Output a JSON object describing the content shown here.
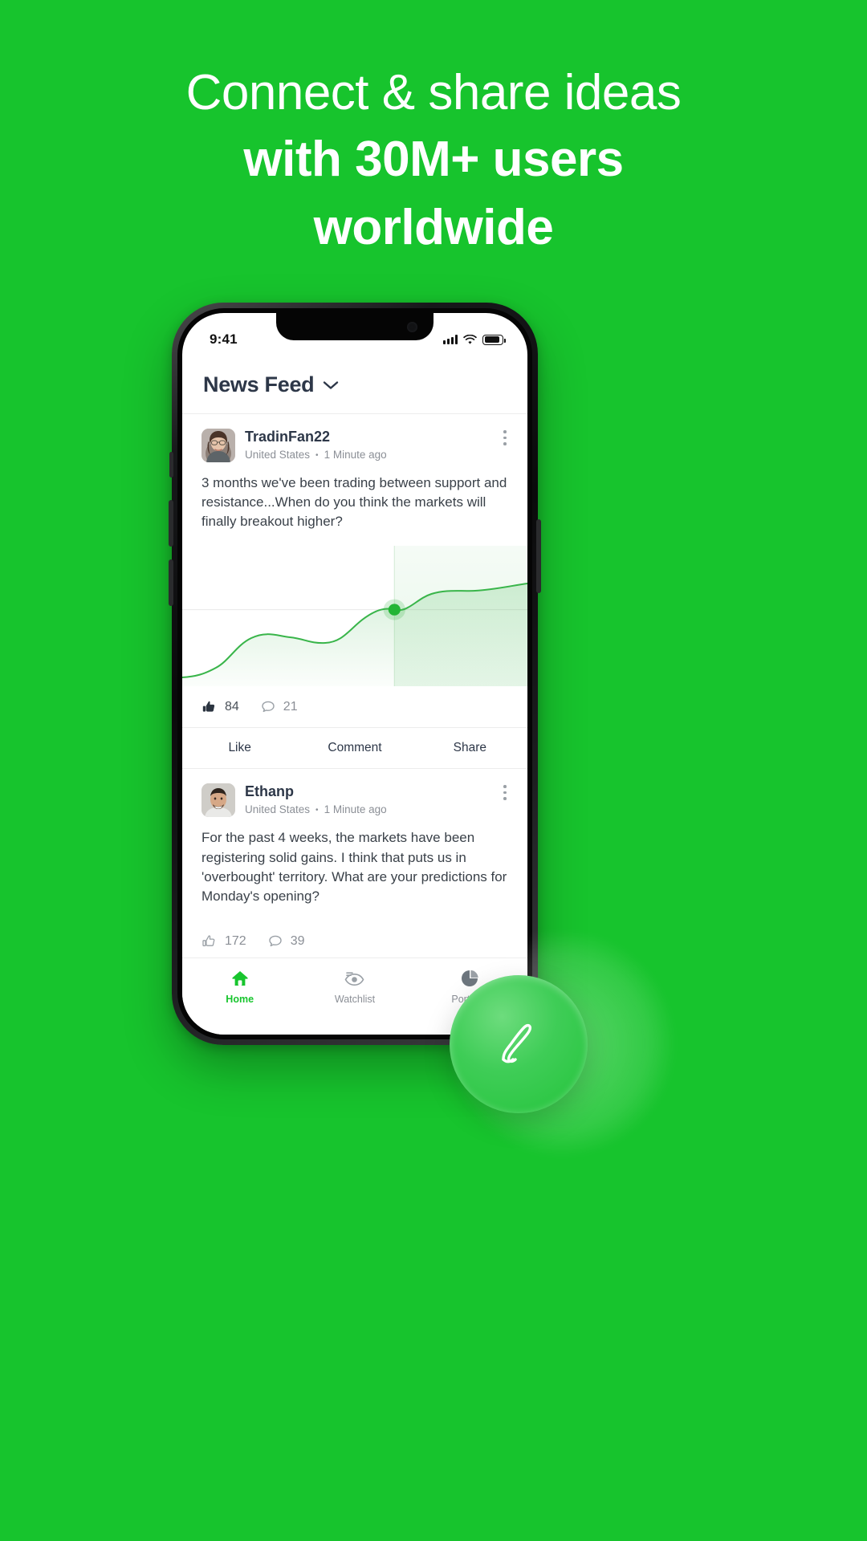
{
  "background_color": "#17C42D",
  "headline": {
    "line1": "Connect & share ideas",
    "line2": "with 30M+ users",
    "line3": "worldwide"
  },
  "phone": {
    "status_bar": {
      "time": "9:41",
      "signal_icon": "cellular-signal-icon",
      "wifi_icon": "wifi-icon",
      "battery_icon": "battery-icon"
    },
    "app_header": {
      "title": "News Feed",
      "chevron_icon": "chevron-down-icon"
    },
    "posts": [
      {
        "author": "TradinFan22",
        "location": "United States",
        "separator": "•",
        "time": "1 Minute ago",
        "menu_icon": "kebab-menu-icon",
        "avatar_name": "avatar-tradinfan22",
        "text": "3 months we've been trading between support and resistance...When do you think the markets will finally breakout higher?",
        "likes": "84",
        "comments": "21",
        "like_icon": "thumbs-up-filled-icon",
        "comment_icon": "comment-bubble-icon",
        "actions": [
          "Like",
          "Comment",
          "Share"
        ],
        "has_chart": true
      },
      {
        "author": "Ethanp",
        "location": "United States",
        "separator": "•",
        "time": "1 Minute ago",
        "menu_icon": "kebab-menu-icon",
        "avatar_name": "avatar-ethanp",
        "text": "For the past 4 weeks, the markets have been registering solid gains. I think that puts us in 'overbought' territory. What are your predictions for Monday's opening?",
        "likes": "172",
        "comments": "39",
        "like_icon": "thumbs-up-outline-icon",
        "comment_icon": "comment-bubble-icon",
        "has_chart": false
      }
    ],
    "bottom_nav": [
      {
        "label": "Home",
        "icon": "home-icon",
        "active": true
      },
      {
        "label": "Watchlist",
        "icon": "eye-watchlist-icon",
        "active": false
      },
      {
        "label": "Portfolio",
        "icon": "pie-chart-icon",
        "active": false
      }
    ]
  },
  "fab": {
    "name": "compose-post-button",
    "icon": "pencil-icon"
  },
  "chart_data": {
    "type": "area",
    "title": "",
    "xlabel": "",
    "ylabel": "",
    "line_color": "#39B54A",
    "fill_color": "#39B54A",
    "marker": {
      "x": 0.615,
      "y": 0.545,
      "color": "#22B534",
      "label": ""
    },
    "gridlines": {
      "horizontal": [
        0.545
      ],
      "vertical": [
        0.615
      ]
    },
    "x": [
      0.0,
      0.08,
      0.16,
      0.24,
      0.32,
      0.4,
      0.48,
      0.56,
      0.615,
      0.68,
      0.76,
      0.84,
      0.92,
      1.0
    ],
    "y": [
      0.06,
      0.07,
      0.1,
      0.2,
      0.33,
      0.38,
      0.35,
      0.33,
      0.455,
      0.56,
      0.62,
      0.62,
      0.66,
      0.7
    ],
    "ylim": [
      0,
      1
    ],
    "xlim": [
      0,
      1
    ],
    "grid": true,
    "legend": "none"
  }
}
